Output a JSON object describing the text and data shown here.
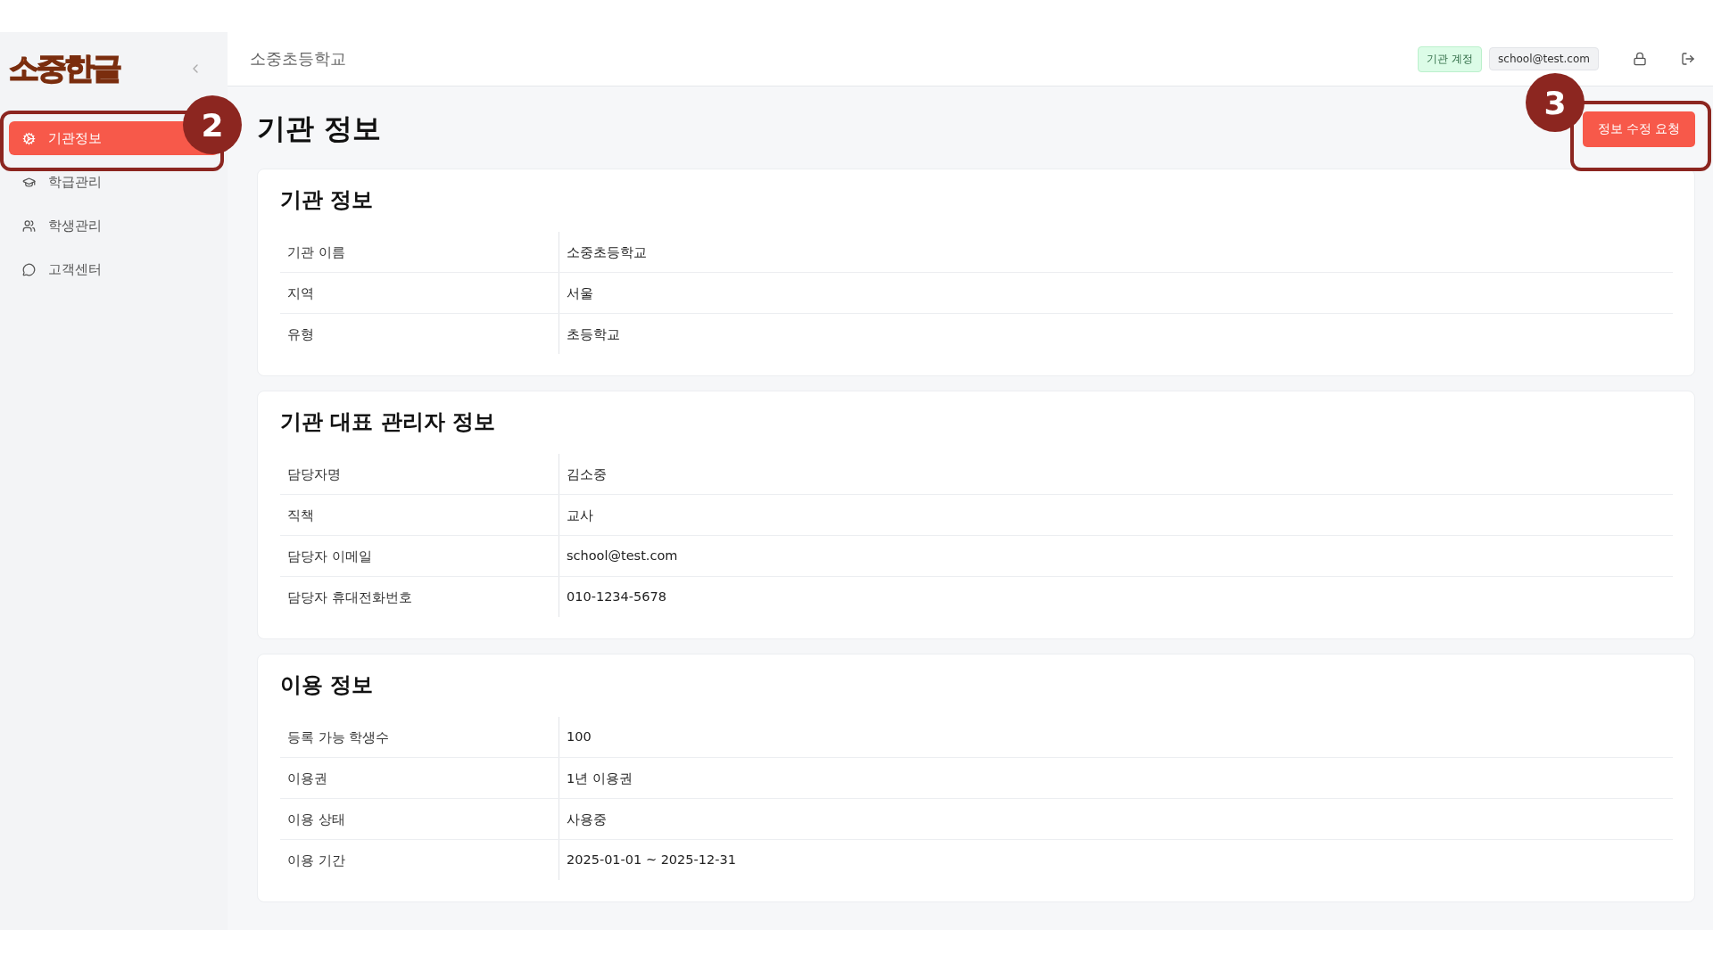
{
  "sidebar": {
    "logo": "소중한글",
    "items": [
      {
        "label": "기관정보",
        "selected": true
      },
      {
        "label": "학급관리",
        "selected": false
      },
      {
        "label": "학생관리",
        "selected": false
      },
      {
        "label": "고객센터",
        "selected": false
      }
    ]
  },
  "header": {
    "school": "소중초등학교",
    "badges": [
      {
        "label": "기관 계정",
        "kind": "role"
      },
      {
        "label": "school@test.com",
        "kind": "account"
      }
    ]
  },
  "page": {
    "title": "기관 정보",
    "action": "정보 수정 요청"
  },
  "sections": [
    {
      "title": "기관 정보",
      "rows": [
        {
          "label": "기관 이름",
          "value": "소중초등학교"
        },
        {
          "label": "지역",
          "value": "서울"
        },
        {
          "label": "유형",
          "value": "초등학교"
        }
      ]
    },
    {
      "title": "기관 대표 관리자 정보",
      "rows": [
        {
          "label": "담당자명",
          "value": "김소중"
        },
        {
          "label": "직책",
          "value": "교사"
        },
        {
          "label": "담당자 이메일",
          "value": "school@test.com"
        },
        {
          "label": "담당자 휴대전화번호",
          "value": "010-1234-5678"
        }
      ]
    },
    {
      "title": "이용 정보",
      "rows": [
        {
          "label": "등록 가능 학생수",
          "value": "100"
        },
        {
          "label": "이용권",
          "value": "1년 이용권"
        },
        {
          "label": "이용 상태",
          "value": "사용중"
        },
        {
          "label": "이용 기간",
          "value": "2025-01-01 ~ 2025-12-31"
        }
      ]
    }
  ],
  "callouts": [
    {
      "number": "2"
    },
    {
      "number": "3"
    }
  ]
}
